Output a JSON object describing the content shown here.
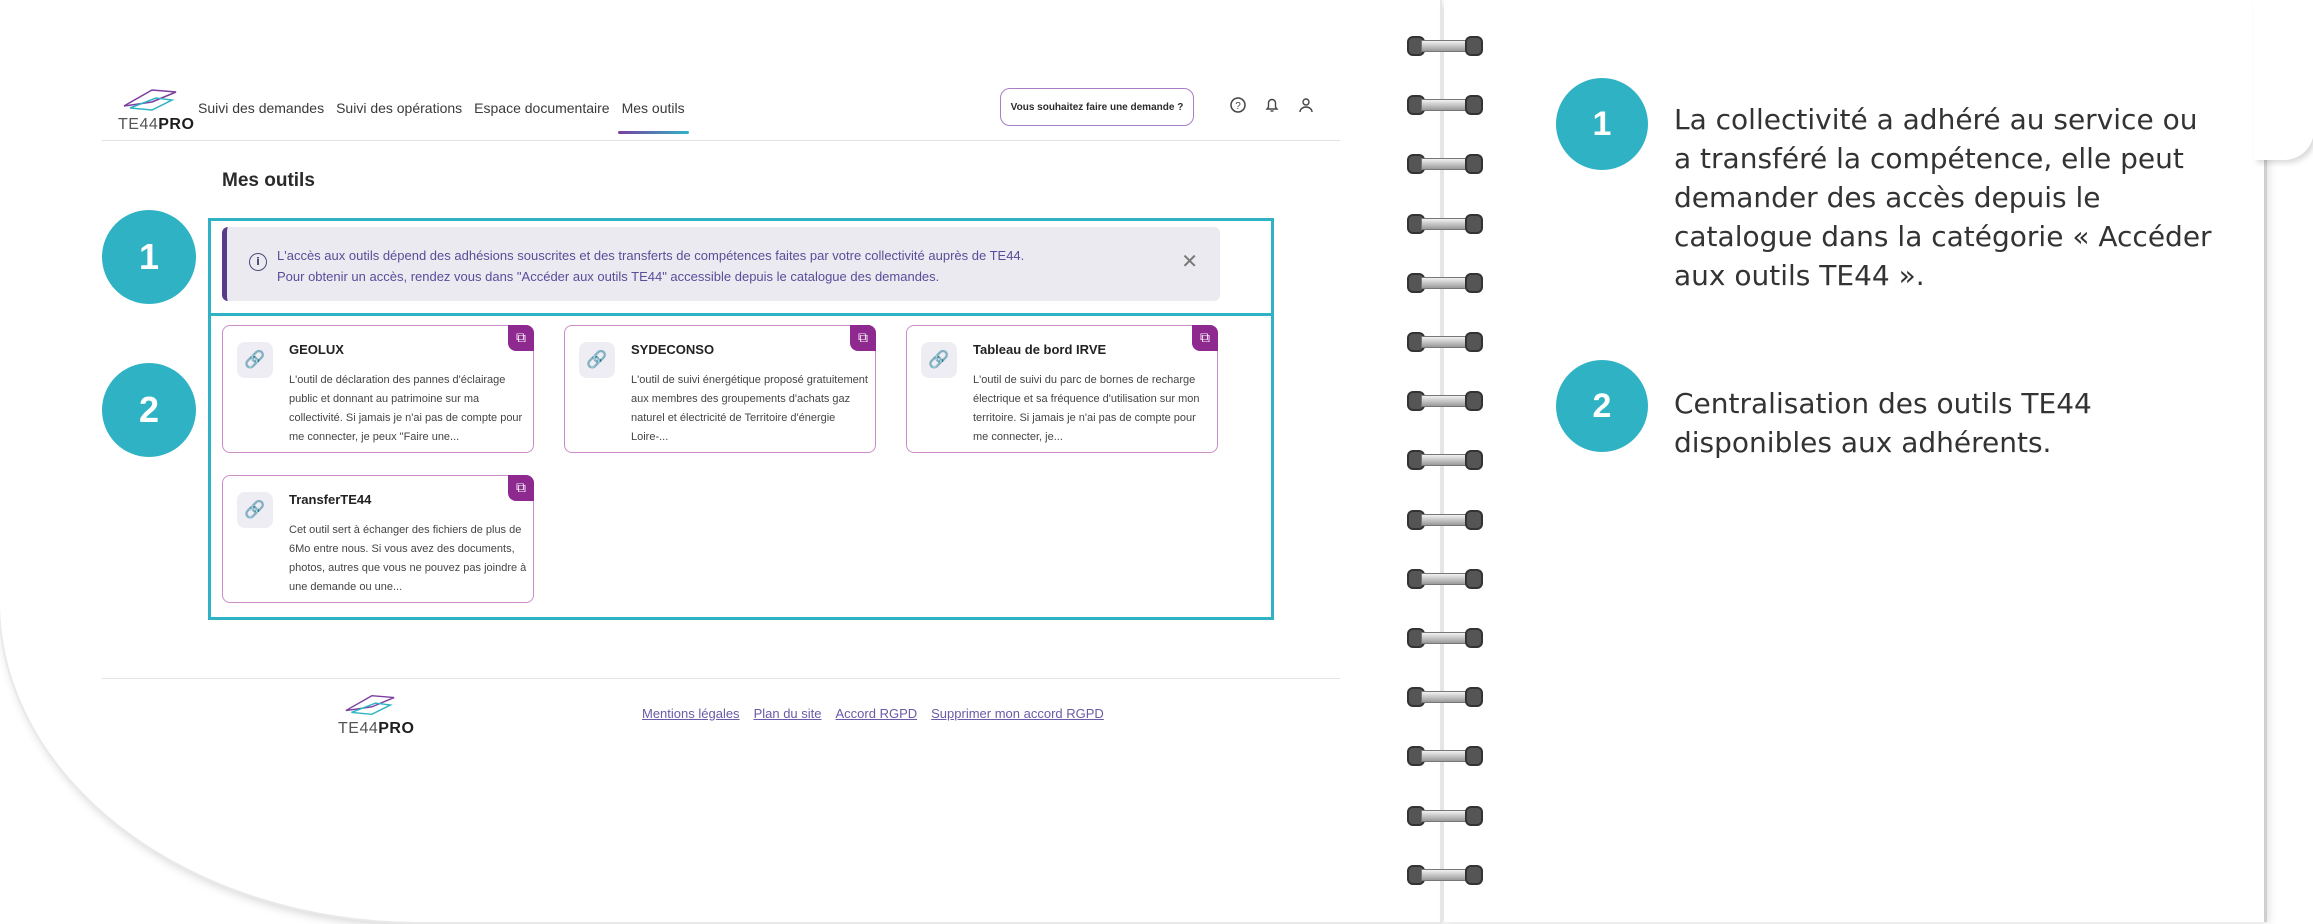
{
  "app": {
    "logo_prefix": "TE44",
    "logo_suffix": "PRO",
    "nav": [
      {
        "label": "Suivi des demandes"
      },
      {
        "label": "Suivi des opérations"
      },
      {
        "label": "Espace documentaire"
      },
      {
        "label": "Mes outils",
        "active": true
      }
    ],
    "cta_label": "Vous souhaitez faire une demande ?",
    "header_icons": [
      "help-icon",
      "bell-icon",
      "user-icon"
    ]
  },
  "main": {
    "title": "Mes outils",
    "alert": {
      "line1": "L'accès aux outils dépend des adhésions souscrites et des transferts de compétences faites par votre collectivité auprès de TE44.",
      "line2": "Pour obtenir un accès, rendez vous dans \"Accéder aux outils TE44\" accessible depuis le catalogue des demandes."
    },
    "tools": [
      {
        "name": "GEOLUX",
        "desc": "L'outil de déclaration des pannes d'éclairage public et donnant au patrimoine sur ma collectivité. Si jamais je n'ai pas de compte pour me connecter, je peux \"Faire une..."
      },
      {
        "name": "SYDECONSO",
        "desc": "L'outil de suivi énergétique proposé gratuitement aux membres des groupements d'achats gaz naturel et électricité de Territoire d'énergie Loire-..."
      },
      {
        "name": "Tableau de bord IRVE",
        "desc": "L'outil de suivi du parc de bornes de recharge électrique et sa fréquence d'utilisation sur mon territoire. Si jamais je n'ai pas de compte pour me connecter, je..."
      },
      {
        "name": "TransferTE44",
        "desc": "Cet outil sert à échanger des fichiers de plus de 6Mo entre nous. Si vous avez des documents, photos, autres que vous ne pouvez pas joindre à une demande ou une..."
      }
    ]
  },
  "footer": {
    "logo_prefix": "TE44",
    "logo_suffix": "PRO",
    "links": [
      "Mentions légales",
      "Plan du site",
      "Accord RGPD",
      "Supprimer mon accord RGPD"
    ]
  },
  "annotations": [
    {
      "number": "1",
      "text": "La collectivité a adhéré au service ou a transféré la compétence, elle peut demander des accès depuis le catalogue dans la catégorie « Accéder aux outils TE44 »."
    },
    {
      "number": "2",
      "text": "Centralisation des outils TE44 disponibles aux adhérents."
    }
  ],
  "colors": {
    "accent": "#2fb3c4",
    "purple": "#8e2a8f",
    "alert_bg": "#ebeaf1"
  }
}
